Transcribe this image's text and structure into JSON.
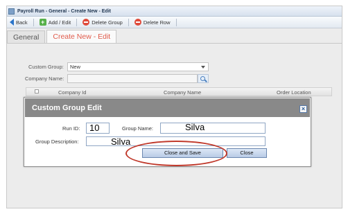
{
  "window": {
    "title": "Payroll Run - General - Create New - Edit"
  },
  "toolbar": {
    "back_label": "Back",
    "add_edit_label": "Add / Edit",
    "delete_group_label": "Delete Group",
    "delete_row_label": "Delete Row"
  },
  "tabs": [
    {
      "label": "General",
      "active": false
    },
    {
      "label": "Create New - Edit",
      "active": true
    }
  ],
  "form": {
    "custom_group_label": "Custom Group:",
    "custom_group_value": "New",
    "company_name_label": "Company Name:",
    "company_name_value": ""
  },
  "grid": {
    "columns": [
      "Company Id",
      "Company Name",
      "Order Location"
    ]
  },
  "modal": {
    "title": "Custom Group Edit",
    "run_id_label": "Run ID:",
    "run_id_value": "10",
    "group_name_label": "Group Name:",
    "group_name_value": "Silva",
    "group_description_label": "Group Description:",
    "group_description_value": "Silva",
    "close_and_save_label": "Close and Save",
    "close_label": "Close"
  },
  "colors": {
    "active_tab_text": "#e05a4a",
    "modal_header": "#898989",
    "highlight_oval": "#c0392b"
  },
  "icons": [
    "app-icon",
    "back-icon",
    "add-icon",
    "delete-icon",
    "search-icon",
    "close-icon"
  ]
}
